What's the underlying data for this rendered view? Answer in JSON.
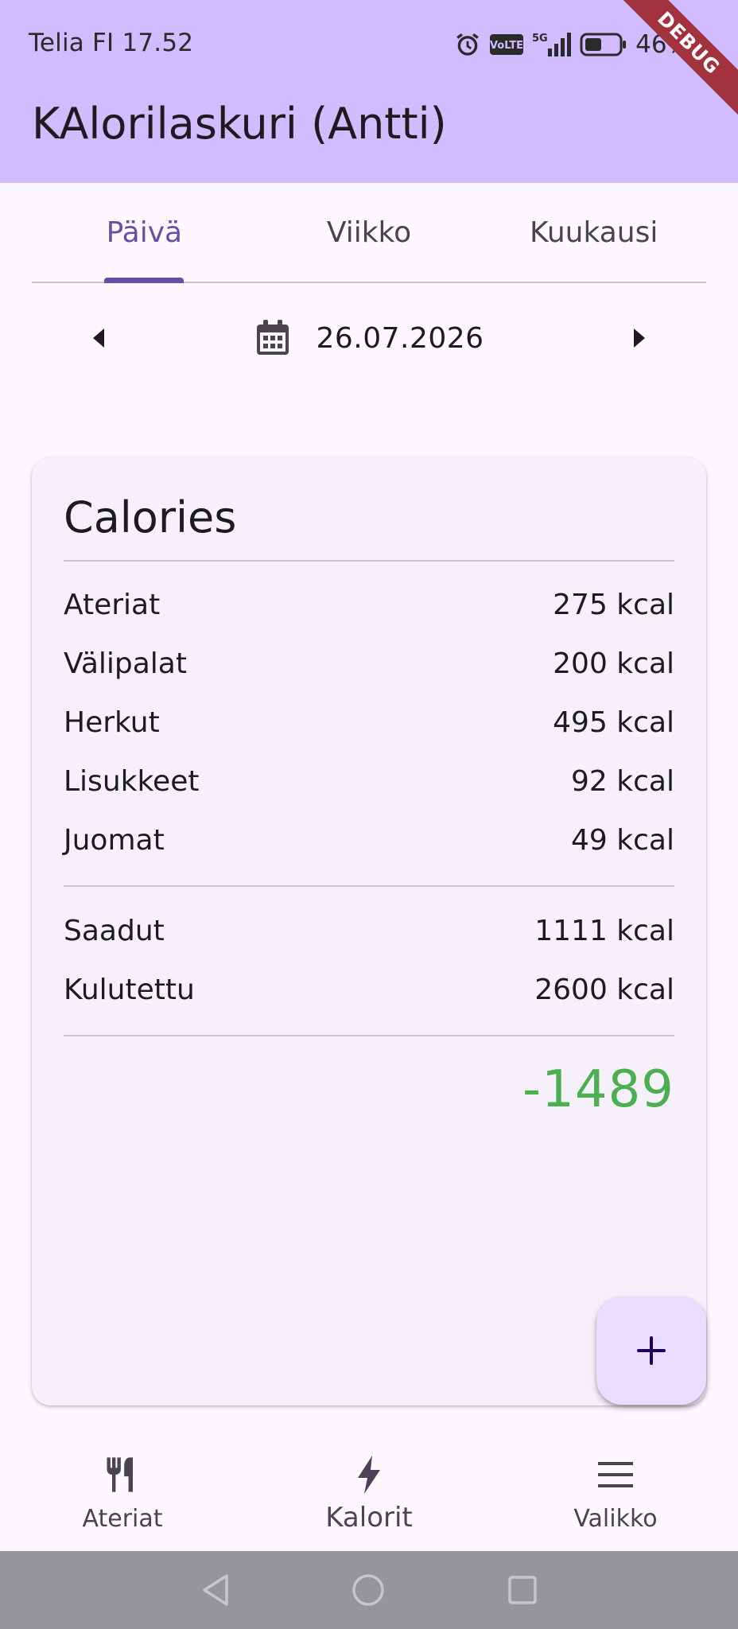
{
  "status_bar": {
    "carrier_time": "Telia FI 17.52",
    "battery_percent": "46%",
    "icons": [
      "alarm-icon",
      "volte-icon",
      "signal-5g-icon",
      "battery-icon"
    ]
  },
  "debug_banner": "DEBUG",
  "app_bar": {
    "title": "KAlorilaskuri (Antti)"
  },
  "tabs": [
    {
      "label": "Päivä",
      "active": true
    },
    {
      "label": "Viikko",
      "active": false
    },
    {
      "label": "Kuukausi",
      "active": false
    }
  ],
  "date_nav": {
    "date": "26.07.2026",
    "prev_icon": "arrow-left-icon",
    "next_icon": "arrow-right-icon",
    "calendar_icon": "calendar-icon"
  },
  "calories_card": {
    "title": "Calories",
    "categories": [
      {
        "label": "Ateriat",
        "value": "275 kcal"
      },
      {
        "label": "Välipalat",
        "value": "200 kcal"
      },
      {
        "label": "Herkut",
        "value": "495 kcal"
      },
      {
        "label": "Lisukkeet",
        "value": "92 kcal"
      },
      {
        "label": "Juomat",
        "value": "49 kcal"
      }
    ],
    "summary": [
      {
        "label": "Saadut",
        "value": "1111 kcal"
      },
      {
        "label": "Kulutettu",
        "value": "2600 kcal"
      }
    ],
    "balance": "-1489",
    "balance_color": "#4caf50"
  },
  "fab": {
    "icon": "plus-icon"
  },
  "bottom_nav": [
    {
      "label": "Ateriat",
      "icon": "fork-knife-icon",
      "active": false
    },
    {
      "label": "Kalorit",
      "icon": "bolt-icon",
      "active": true
    },
    {
      "label": "Valikko",
      "icon": "menu-icon",
      "active": false
    }
  ],
  "colors": {
    "app_bar": "#d0bcff",
    "primary": "#6750a4",
    "fab": "#eaddff",
    "card": "#f6f0fa",
    "system_nav": "#97949b"
  }
}
